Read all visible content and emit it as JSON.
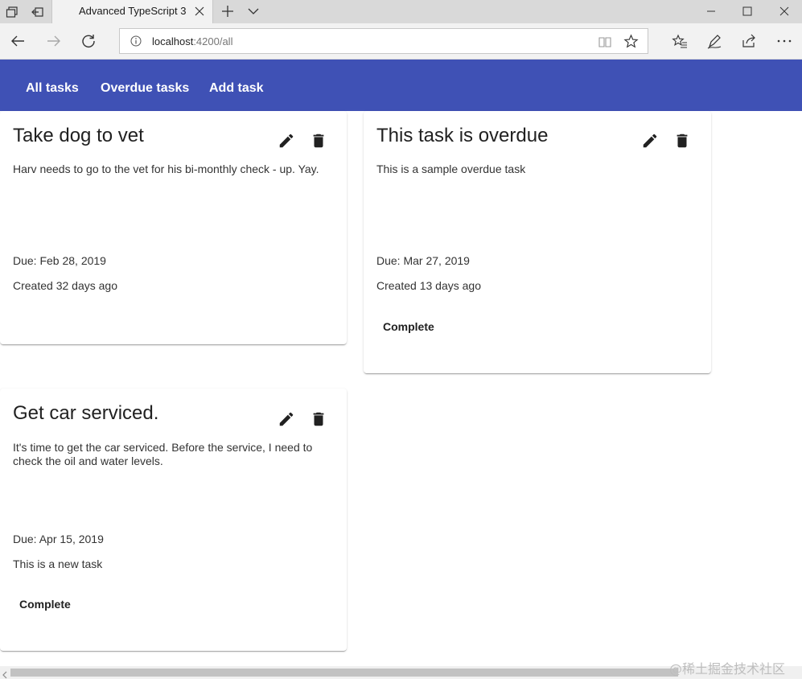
{
  "browser": {
    "tab_title": "Advanced TypeScript 3",
    "url_host": "localhost",
    "url_port_path": ":4200/all"
  },
  "nav": {
    "all_tasks": "All tasks",
    "overdue_tasks": "Overdue tasks",
    "add_task": "Add task"
  },
  "colors": {
    "primary": "#3f51b5"
  },
  "tasks": [
    {
      "title": "Take dog to vet",
      "description": "Harv needs to go to the vet for his bi-monthly check - up. Yay.",
      "due": "Due: Feb 28, 2019",
      "created": "Created 32 days ago",
      "complete_label": ""
    },
    {
      "title": "This task is overdue",
      "description": "This is a sample overdue task",
      "due": "Due: Mar 27, 2019",
      "created": "Created 13 days ago",
      "complete_label": "Complete"
    },
    {
      "title": "Get car serviced.",
      "description": "It's time to get the car serviced. Before the service, I need to check the oil and water levels.",
      "due": "Due: Apr 15, 2019",
      "created": "This is a new task",
      "complete_label": "Complete"
    }
  ],
  "icons": {
    "edit": "pencil-icon",
    "delete": "trash-icon"
  },
  "watermark": "@稀土掘金技术社区"
}
